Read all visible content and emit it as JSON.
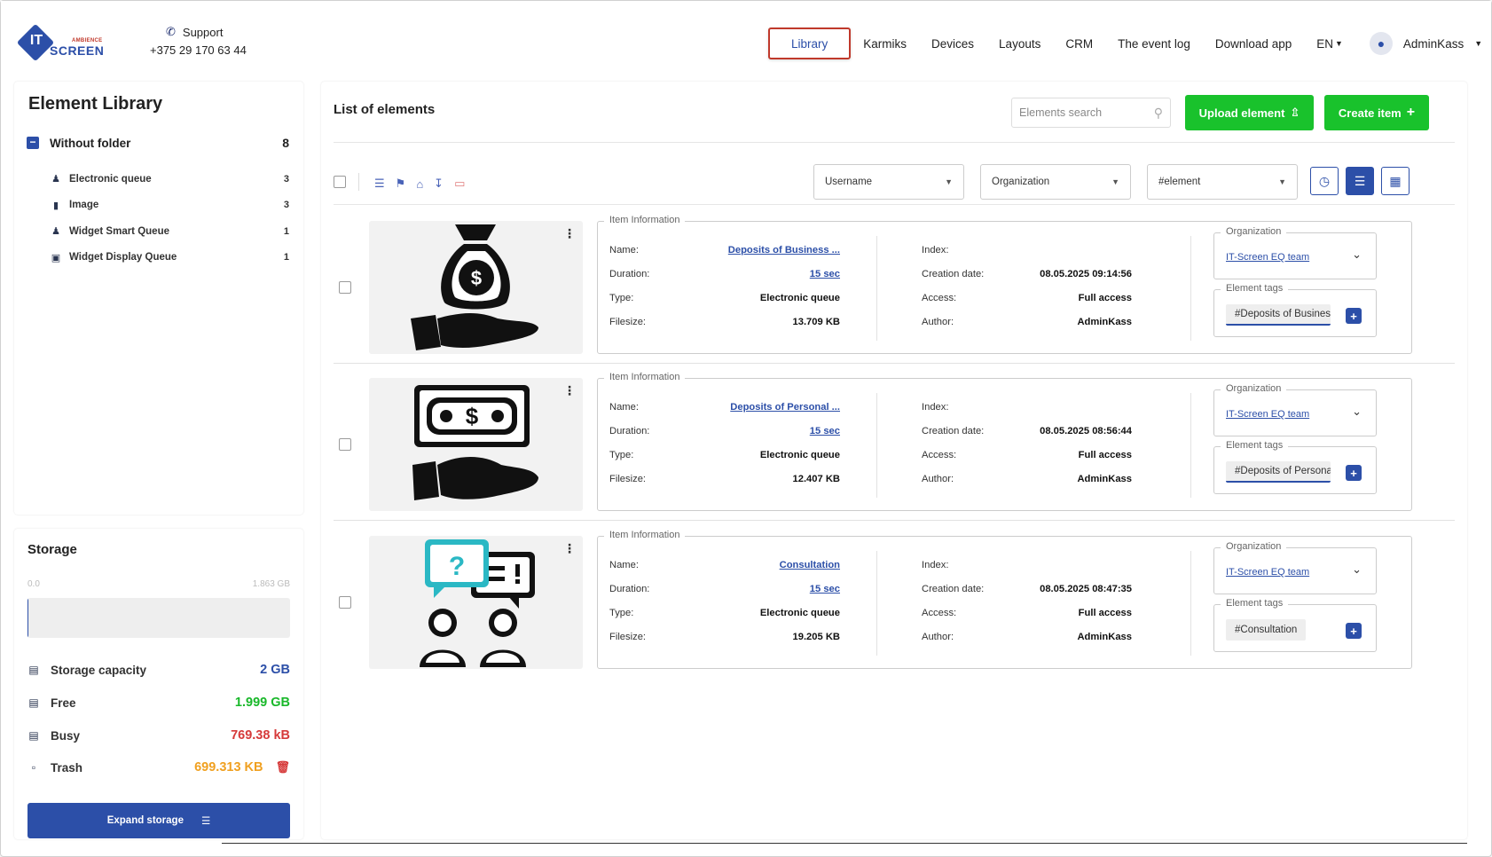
{
  "header": {
    "logo": {
      "it": "IT",
      "ambience": "AMBIENCE",
      "screen": "SCREEN"
    },
    "support": {
      "label": "Support",
      "phone": "+375 29 170 63 44"
    },
    "nav": [
      {
        "label": "Library",
        "active": true
      },
      {
        "label": "Karmiks"
      },
      {
        "label": "Devices"
      },
      {
        "label": "Layouts"
      },
      {
        "label": "CRM"
      },
      {
        "label": "The event log"
      },
      {
        "label": "Download app"
      }
    ],
    "language": "EN",
    "user": "AdminKass"
  },
  "library": {
    "title": "Element Library",
    "folder": {
      "label": "Without folder",
      "count": "8"
    },
    "items": [
      {
        "icon": "users-icon",
        "label": "Electronic queue",
        "count": "3"
      },
      {
        "icon": "file-icon",
        "label": "Image",
        "count": "3"
      },
      {
        "icon": "users-icon",
        "label": "Widget Smart Queue",
        "count": "1"
      },
      {
        "icon": "monitor-icon",
        "label": "Widget Display Queue",
        "count": "1"
      }
    ]
  },
  "storage": {
    "title": "Storage",
    "min": "0.0",
    "max": "1.863 GB",
    "used_fraction": 0.0004,
    "rows": [
      {
        "icon": "server-icon",
        "label": "Storage capacity",
        "value": "2 GB",
        "color": "#2c4fa8"
      },
      {
        "icon": "server-outline-icon",
        "label": "Free",
        "value": "1.999 GB",
        "color": "#19b82a"
      },
      {
        "icon": "server-icon",
        "label": "Busy",
        "value": "769.38 kB",
        "color": "#d63a3a"
      },
      {
        "icon": "trash-icon",
        "label": "Trash",
        "value": "699.313 KB",
        "color": "#f0a020"
      }
    ],
    "expand_label": "Expand storage"
  },
  "main": {
    "title": "List of elements",
    "search_placeholder": "Elements search",
    "upload_label": "Upload element",
    "create_label": "Create item",
    "filters": {
      "username": "Username",
      "organization": "Organization",
      "tag": "#element"
    }
  },
  "labels": {
    "item_information": "Item Information",
    "name": "Name:",
    "duration": "Duration:",
    "type": "Type:",
    "filesize": "Filesize:",
    "index": "Index:",
    "creation_date": "Creation date:",
    "access": "Access:",
    "author": "Author:",
    "organization": "Organization",
    "element_tags": "Element tags"
  },
  "elements": [
    {
      "name": "Deposits of Business ...",
      "duration": "15 sec",
      "type": "Electronic queue",
      "filesize": "13.709 KB",
      "index": "",
      "creation_date": "08.05.2025 09:14:56",
      "access": "Full access",
      "author": "AdminKass",
      "organization": "IT-Screen EQ team",
      "tag": "#Deposits of Busines",
      "thumb": "money-bag-hand"
    },
    {
      "name": "Deposits of Personal ...",
      "duration": "15 sec",
      "type": "Electronic queue",
      "filesize": "12.407 KB",
      "index": "",
      "creation_date": "08.05.2025 08:56:44",
      "access": "Full access",
      "author": "AdminKass",
      "organization": "IT-Screen EQ team",
      "tag": "#Deposits of Persona",
      "thumb": "cash-hand"
    },
    {
      "name": "Consultation",
      "duration": "15 sec",
      "type": "Electronic queue",
      "filesize": "19.205 KB",
      "index": "",
      "creation_date": "08.05.2025 08:47:35",
      "access": "Full access",
      "author": "AdminKass",
      "organization": "IT-Screen EQ team",
      "tag": "#Consultation",
      "thumb": "consultation"
    }
  ]
}
